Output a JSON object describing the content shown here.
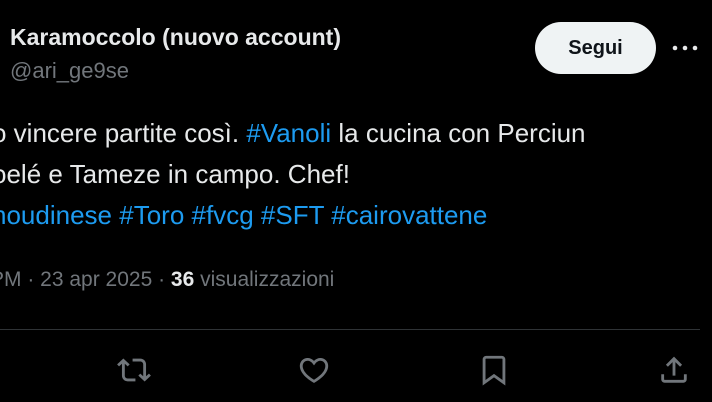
{
  "user": {
    "display_name": "Karamoccolo (nuovo account)",
    "handle": "@ari_ge9se"
  },
  "follow_label": "Segui",
  "more_label": "···",
  "tweet": {
    "line1_prefix": "o vincere partite così. ",
    "line1_tag": "#Vanoli",
    "line1_suffix": " la cucina con Perciun",
    "line2": "oelé e Tameze in campo. Chef!",
    "tags": [
      "noudinese",
      "#Toro",
      "#fvcg",
      "#SFT",
      "#cairovattene"
    ]
  },
  "meta": {
    "time_date": "PM · 23 apr 2025 · ",
    "views_count": "36",
    "views_label": " visualizzazioni"
  },
  "actions": [
    {
      "name": "repost",
      "icon": "repost-icon"
    },
    {
      "name": "like",
      "icon": "heart-icon"
    },
    {
      "name": "bookmark",
      "icon": "bookmark-icon"
    },
    {
      "name": "share",
      "icon": "share-icon"
    }
  ],
  "colors": {
    "background": "#000000",
    "text": "#e7e9ea",
    "muted": "#71767b",
    "link": "#1d9bf0",
    "button_bg": "#eff3f4",
    "divider": "#2f3336"
  }
}
